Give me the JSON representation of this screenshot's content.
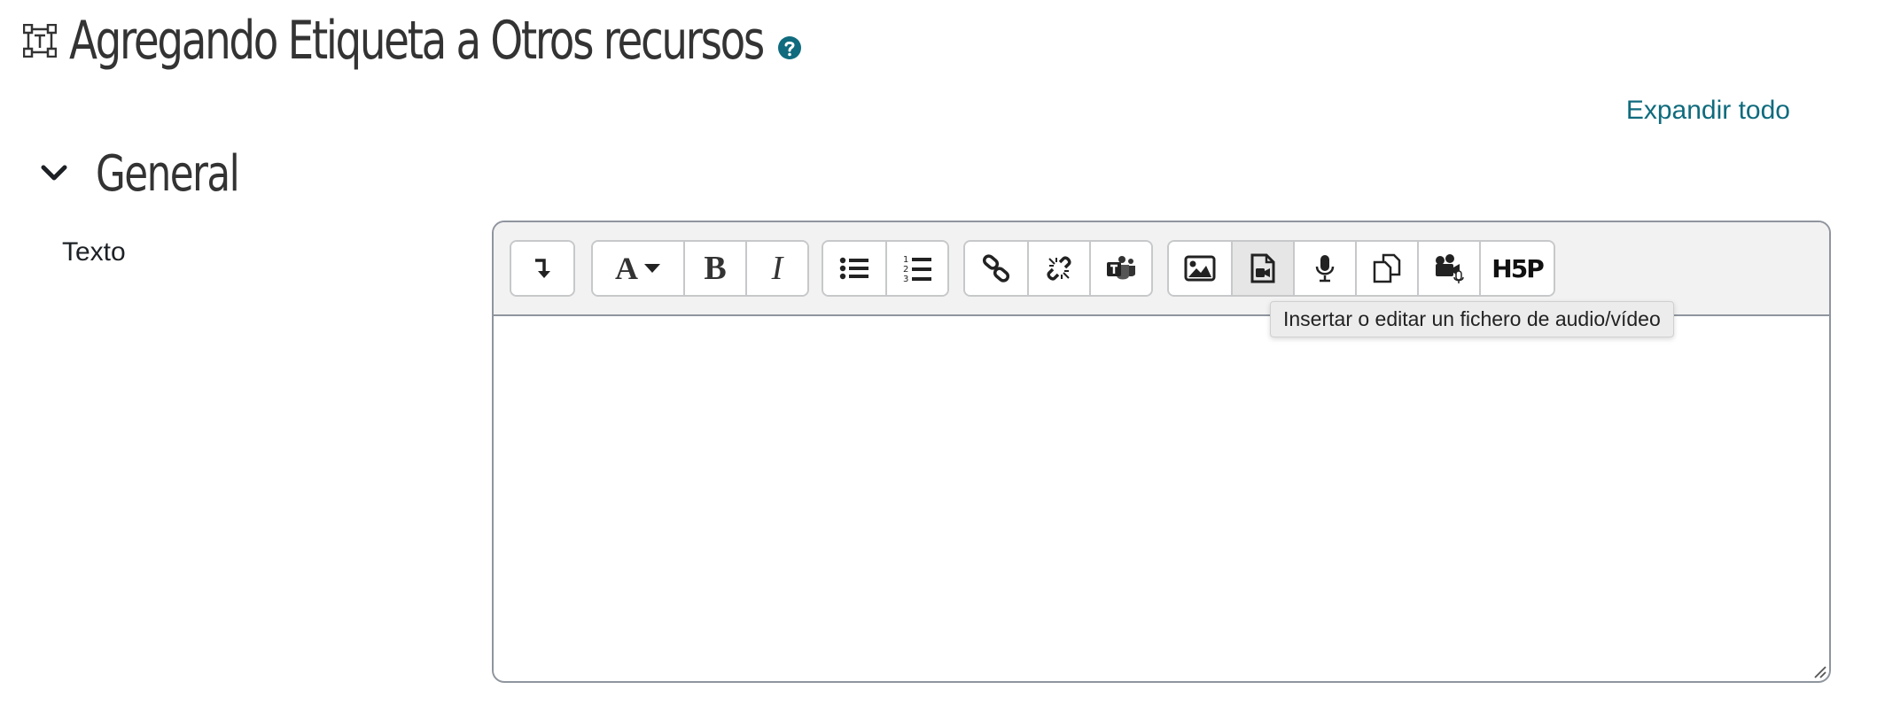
{
  "page": {
    "title": "Agregando Etiqueta a Otros recursos",
    "title_icon": "label-module-icon",
    "help_icon": "help-icon",
    "expand_all": "Expandir todo"
  },
  "section": {
    "title": "General",
    "toggle_icon": "chevron-down-icon"
  },
  "field": {
    "label": "Texto",
    "value": ""
  },
  "toolbar": {
    "groups": [
      {
        "buttons": [
          {
            "name": "show-more-buttons",
            "icon": "arrow-down-turn-icon"
          }
        ]
      },
      {
        "buttons": [
          {
            "name": "paragraph-styles",
            "label": "A",
            "icon": "caret-down-icon"
          },
          {
            "name": "bold",
            "label": "B"
          },
          {
            "name": "italic",
            "label": "I"
          }
        ]
      },
      {
        "buttons": [
          {
            "name": "unordered-list",
            "icon": "bullet-list-icon"
          },
          {
            "name": "ordered-list",
            "icon": "numbered-list-icon"
          }
        ]
      },
      {
        "buttons": [
          {
            "name": "link",
            "icon": "link-icon"
          },
          {
            "name": "unlink",
            "icon": "unlink-icon"
          },
          {
            "name": "teams-meeting",
            "icon": "teams-icon"
          }
        ]
      },
      {
        "buttons": [
          {
            "name": "image",
            "icon": "image-icon"
          },
          {
            "name": "media",
            "icon": "video-file-icon",
            "active": true
          },
          {
            "name": "record-audio",
            "icon": "microphone-icon"
          },
          {
            "name": "manage-files",
            "icon": "files-icon"
          },
          {
            "name": "record-video",
            "icon": "video-camera-icon"
          },
          {
            "name": "h5p",
            "label": "H5P",
            "icon": "h5p-icon"
          }
        ]
      }
    ]
  },
  "tooltip": {
    "text": "Insertar o editar un fichero de audio/vídeo"
  },
  "colors": {
    "link": "#0f6b7d",
    "help": "#0f6b7d",
    "border": "#8f959e",
    "toolbar_bg": "#f2f2f2"
  }
}
